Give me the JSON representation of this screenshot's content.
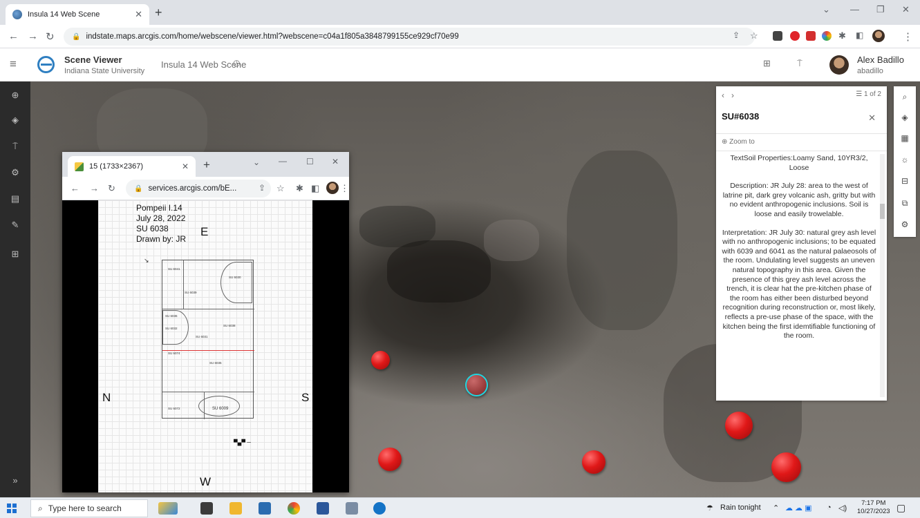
{
  "browser": {
    "tab_title": "Insula 14 Web Scene",
    "url": "indstate.maps.arcgis.com/home/webscene/viewer.html?webscene=c04a1f805a3848799155ce929cf70e99"
  },
  "app": {
    "title": "Scene Viewer",
    "org": "Indiana State University",
    "scene_title": "Insula 14 Web Scene",
    "user_name": "Alex Badillo",
    "user_id": "abadillo"
  },
  "popup": {
    "pager": "1 of 2",
    "title": "SU#6038",
    "zoom_label": "Zoom to",
    "paragraphs": [
      "TextSoil Properties:Loamy Sand, 10YR3/2, Loose",
      "Description: JR July 28: area to the west of latrine pit, dark grey volcanic ash, gritty but with no evident anthropogenic inclusions. Soil is loose and easily trowelable.",
      "Interpretation: JR July 30: natural grey ash level with no anthropogenic inclusions; to be equated with 6039 and 6041 as the natural palaeosols of the room. Undulating level suggests an uneven natural topography in this area. Given the presence of this grey ash level across the trench, it is clear hat the pre-kitchen phase of the room has either been disturbed beyond recognition during reconstruction or, most likely, reflects a pre-use phase of the space, with the kitchen being the first idemtifiable functioning of the room."
    ]
  },
  "float_window": {
    "tab_title": "15 (1733×2367)",
    "url": "services.arcgis.com/bE...",
    "sheet_lines": [
      "Pompeii I.14",
      "July 28, 2022",
      "SU 6038",
      "Drawn by: JR"
    ],
    "compass": {
      "north": "N",
      "south": "S",
      "east": "E",
      "west": "W"
    },
    "plan_labels": [
      "SU 6041",
      "SU 6030",
      "SU 6039",
      "SU 6036",
      "SU 6032",
      "SU 6038",
      "SU 6074",
      "SU 6035",
      "SU 6031",
      "SU 6072",
      "SU 6009"
    ]
  },
  "taskbar": {
    "search_placeholder": "Type here to search",
    "weather": "Rain tonight",
    "time": "7:17 PM",
    "date": "10/27/2023"
  },
  "icons": {
    "left_rail": [
      "plus-circle-icon",
      "layers-icon",
      "slides-icon",
      "settings-icon",
      "legend-icon",
      "measure-icon",
      "grid-icon"
    ],
    "right_rail": [
      "search-icon",
      "layers-icon",
      "basemap-icon",
      "daylight-icon",
      "measure-icon",
      "share-icon",
      "settings-icon"
    ]
  },
  "colors": {
    "marker": "#e01818",
    "selected_ring": "#1fd6e0",
    "brand": "#2f7fc1"
  }
}
